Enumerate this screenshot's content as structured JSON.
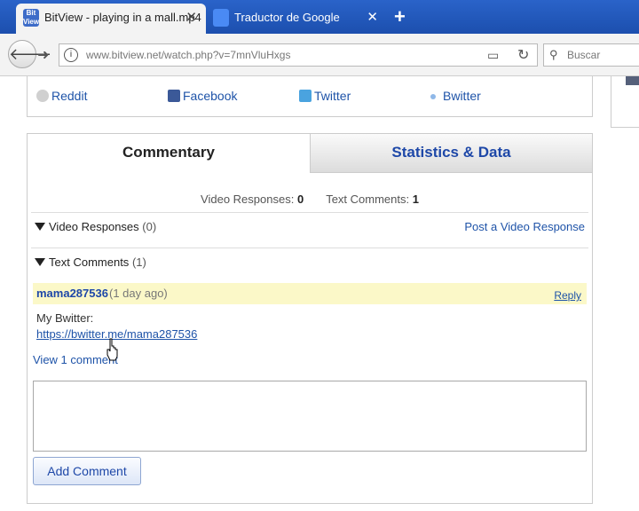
{
  "browser": {
    "tabs": [
      {
        "label": "BitView - playing in a mall.mp4",
        "favicon": "bitview-logo",
        "favicon_text": "Bit View",
        "active": true
      },
      {
        "label": "Traductor de Google",
        "favicon": "google-translate-icon",
        "active": false
      }
    ],
    "url": "www.bitview.net/watch.php?v=7mnVluHxgs",
    "search_placeholder": "Buscar"
  },
  "share": {
    "items": [
      {
        "label": "Reddit",
        "icon": "reddit-icon"
      },
      {
        "label": "Facebook",
        "icon": "facebook-icon"
      },
      {
        "label": "Twitter",
        "icon": "twitter-icon"
      },
      {
        "label": "Bwitter",
        "icon": "bwitter-icon"
      }
    ]
  },
  "comments": {
    "tabs": [
      {
        "label": "Commentary",
        "active": true
      },
      {
        "label": "Statistics & Data",
        "active": false
      }
    ],
    "counts": {
      "video_label": "Video Responses:",
      "video_value": "0",
      "text_label": "Text Comments:",
      "text_value": "1"
    },
    "video_responses": {
      "label": "Video Responses",
      "count": "(0)",
      "post_link": "Post a Video Response"
    },
    "text_comments": {
      "label": "Text Comments",
      "count": "(1)"
    },
    "comment": {
      "user": "mama287536",
      "time": "(1 day ago)",
      "reply": "Reply",
      "text": "My Bwitter:",
      "link": "https://bwitter.me/mama287536"
    },
    "view_more": "View 1 comment",
    "add_button": "Add Comment"
  },
  "colors": {
    "tabstrip": "#2a63c9",
    "link": "#1e53a8",
    "comment_highlight": "#fbf8c8"
  }
}
